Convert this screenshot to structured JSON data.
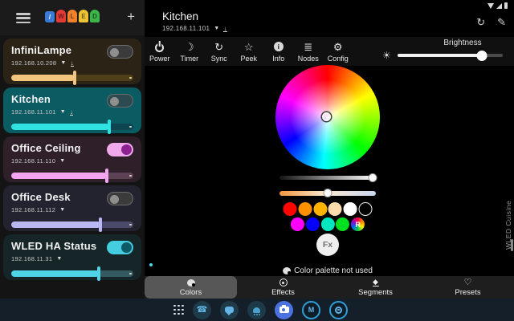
{
  "sidebar": {
    "logo": {
      "name": "WLED",
      "chip_color": "#3a7bd5",
      "led_colors": [
        "#e43b36",
        "#f0812b",
        "#eec333",
        "#3cb54a"
      ],
      "led_letters": [
        "W",
        "L",
        "E",
        "D"
      ]
    },
    "add_button": "+",
    "devices": [
      {
        "name": "InfiniLampe",
        "ip": "192.168.10.208",
        "update_available": true,
        "power_on": false,
        "brightness_pct": 52,
        "bg": "#2b2316",
        "fill": "#f1c57e",
        "dim": "#4f3f17",
        "toggle_track": "#3b3b3b",
        "toggle_thumb": "#8f8f8f"
      },
      {
        "name": "Kitchen",
        "ip": "192.168.11.101",
        "update_available": true,
        "power_on": false,
        "brightness_pct": 80,
        "bg": "#0b5b63",
        "fill": "#30e2e2",
        "dim": "#0e4550",
        "toggle_track": "#2c4a50",
        "toggle_thumb": "#8f8f8f"
      },
      {
        "name": "Office Ceiling",
        "ip": "192.168.11.110",
        "update_available": false,
        "power_on": true,
        "brightness_pct": 78,
        "bg": "#2e1f29",
        "fill": "#f3a6ef",
        "dim": "#5d4154",
        "toggle_track": "#f0aaec",
        "toggle_thumb": "#8c2391"
      },
      {
        "name": "Office Desk",
        "ip": "192.168.11.112",
        "update_available": false,
        "power_on": false,
        "brightness_pct": 73,
        "bg": "#232330",
        "fill": "#bab8f3",
        "dim": "#4b4969",
        "toggle_track": "#3b3b3b",
        "toggle_thumb": "#8f8f8f"
      },
      {
        "name": "WLED HA Status",
        "ip": "192.168.11.31",
        "update_available": false,
        "power_on": true,
        "brightness_pct": 72,
        "bg": "#152528",
        "fill": "#4ed3e7",
        "dim": "#355960",
        "toggle_track": "#44ccdf",
        "toggle_thumb": "#0e5a68"
      }
    ]
  },
  "main": {
    "title": "Kitchen",
    "ip": "192.168.11.101",
    "toolbar": {
      "items": [
        {
          "label": "Power",
          "icon": "power-icon"
        },
        {
          "label": "Timer",
          "icon": "moon-icon"
        },
        {
          "label": "Sync",
          "icon": "sync-icon"
        },
        {
          "label": "Peek",
          "icon": "star-icon"
        },
        {
          "label": "Info",
          "icon": "info-icon"
        },
        {
          "label": "Nodes",
          "icon": "list-icon"
        },
        {
          "label": "Config",
          "icon": "gear-icon"
        }
      ],
      "brightness_label": "Brightness",
      "brightness_pct": 80
    },
    "color_wheel": {
      "selected_hue": "center-white"
    },
    "value_slider_pct": 97,
    "kelvin_slider_pct": 50,
    "swatches_row1": [
      "#ff0500",
      "#ff9000",
      "#ffb300",
      "#ffdcae",
      "#ffffff",
      "#000000"
    ],
    "swatches_row2": [
      "#ff00ff",
      "#0500ff",
      "#00e6c0",
      "#00e020",
      "rainbow"
    ],
    "rainbow_label": "R",
    "fx_button": "Fx",
    "palette_status": "Color palette not used",
    "watermark": "WLED Cuisine"
  },
  "tabs": [
    {
      "label": "Colors",
      "active": true,
      "icon": "palette-icon"
    },
    {
      "label": "Effects",
      "active": false,
      "icon": "effects-icon"
    },
    {
      "label": "Segments",
      "active": false,
      "icon": "segments-icon"
    },
    {
      "label": "Presets",
      "active": false,
      "icon": "heart-icon"
    }
  ],
  "taskbar": {
    "icons": [
      "app-drawer-grid",
      "phone-app",
      "messages-app",
      "octopus-app",
      "camera-app",
      "m-app",
      "circles-app"
    ]
  },
  "status_bar": {
    "icons": [
      "wifi",
      "signal",
      "battery"
    ]
  }
}
